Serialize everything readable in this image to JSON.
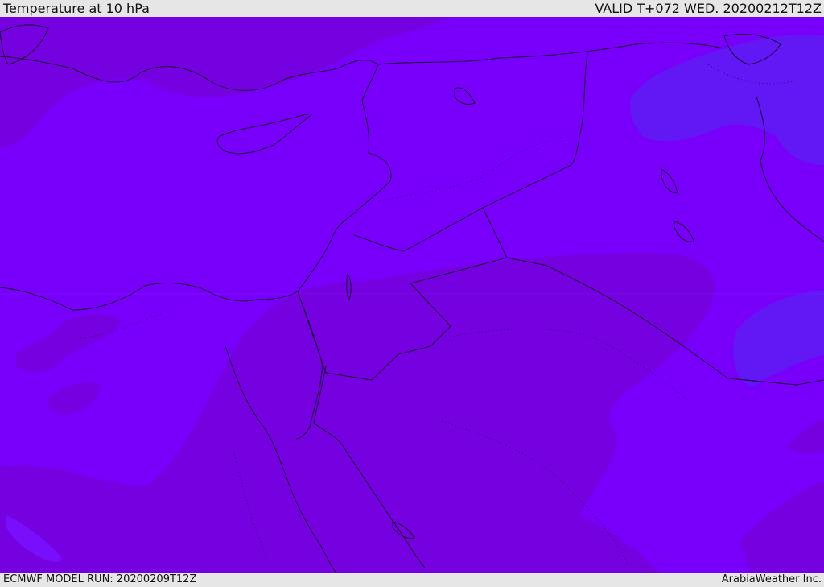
{
  "header": {
    "title": "Temperature at 10 hPa",
    "valid_time": "VALID T+072 WED. 20200212T12Z"
  },
  "footer": {
    "model_run": "ECMWF MODEL RUN: 20200209T12Z",
    "credit": "ArabiaWeather Inc."
  },
  "colors": {
    "base_fill": "#7800fb",
    "cold_zone": "#7500e0",
    "warm_zone": "#6217f5",
    "borders": "#1a0033"
  }
}
